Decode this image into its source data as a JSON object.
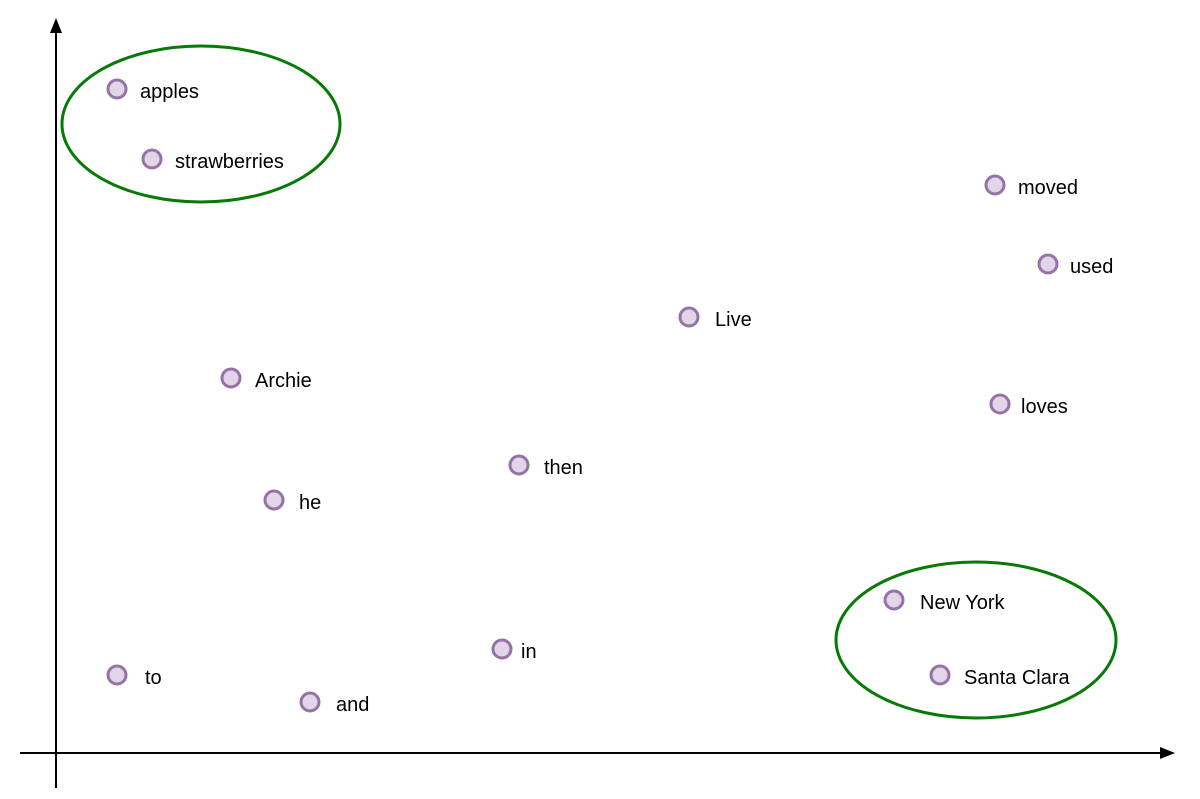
{
  "colors": {
    "axis": "#000000",
    "dot_fill": "#e1d5e7",
    "dot_stroke": "#9673a6",
    "cluster_stroke": "#067a06",
    "label": "#000000"
  },
  "points": [
    {
      "id": "apples",
      "label": "apples"
    },
    {
      "id": "strawberries",
      "label": "strawberries"
    },
    {
      "id": "moved",
      "label": "moved"
    },
    {
      "id": "used",
      "label": "used"
    },
    {
      "id": "live",
      "label": "Live"
    },
    {
      "id": "archie",
      "label": "Archie"
    },
    {
      "id": "loves",
      "label": "loves"
    },
    {
      "id": "then",
      "label": "then"
    },
    {
      "id": "he",
      "label": "he"
    },
    {
      "id": "new-york",
      "label": "New York"
    },
    {
      "id": "in",
      "label": "in"
    },
    {
      "id": "to",
      "label": "to"
    },
    {
      "id": "santa-clara",
      "label": "Santa Clara"
    },
    {
      "id": "and",
      "label": "and"
    }
  ],
  "clusters": [
    {
      "id": "fruits",
      "members": [
        "apples",
        "strawberries"
      ]
    },
    {
      "id": "cities",
      "members": [
        "New York",
        "Santa Clara"
      ]
    }
  ]
}
